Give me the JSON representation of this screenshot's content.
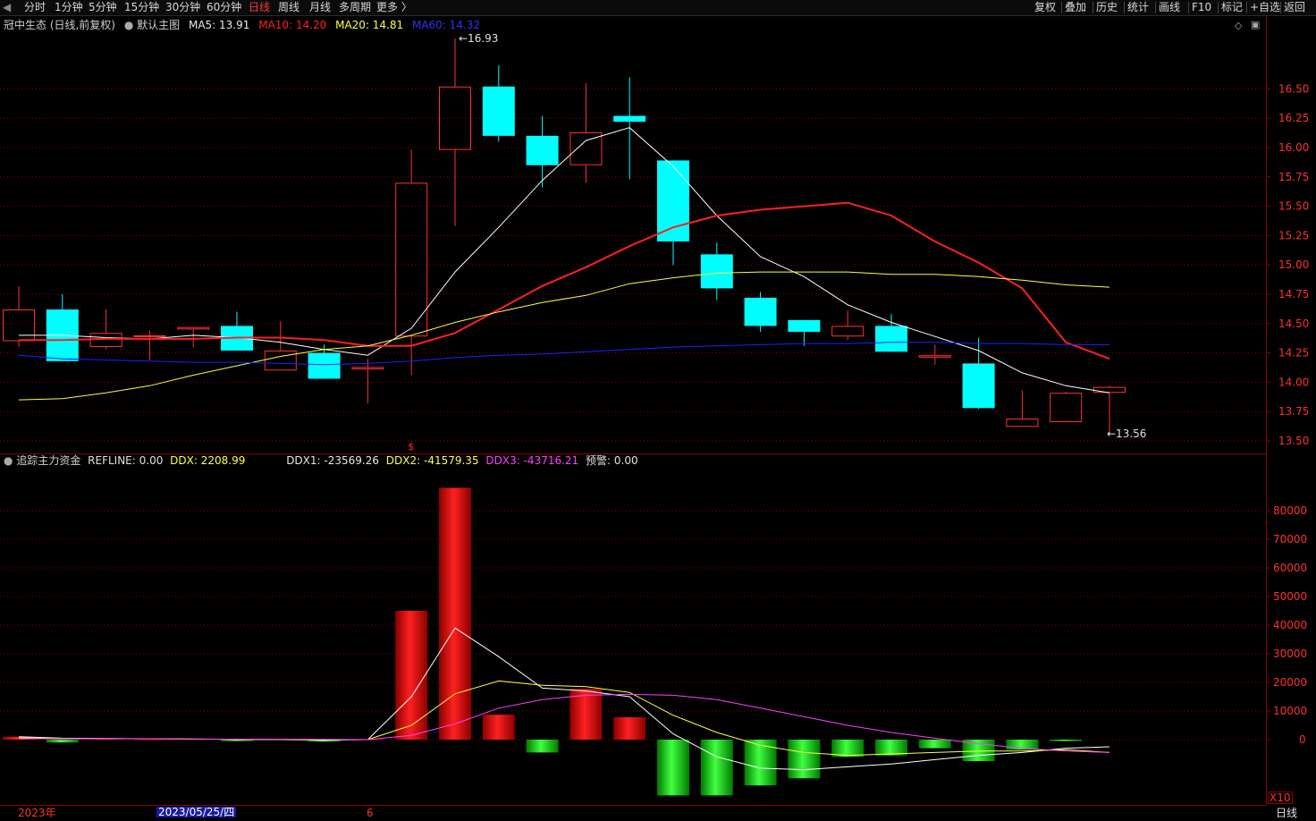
{
  "toolbar": {
    "left_items": [
      {
        "label": "分时",
        "active": false
      },
      {
        "label": "1分钟",
        "active": false
      },
      {
        "label": "5分钟",
        "active": false
      },
      {
        "label": "15分钟",
        "active": false
      },
      {
        "label": "30分钟",
        "active": false
      },
      {
        "label": "60分钟",
        "active": false
      },
      {
        "label": "日线",
        "active": true
      },
      {
        "label": "周线",
        "active": false
      },
      {
        "label": "月线",
        "active": false
      },
      {
        "label": "多周期",
        "active": false
      },
      {
        "label": "更多 〉",
        "active": false
      }
    ],
    "right_items": [
      "复权",
      "叠加",
      "历史",
      "统计",
      "画线",
      "F10",
      "标记",
      "+自选",
      "返回"
    ]
  },
  "colors": {
    "up": "#ff3232",
    "down": "#00ffff",
    "ma5": "#ffffff",
    "ma10": "#ff2020",
    "ma20": "#ffff40",
    "ma60": "#2020ff",
    "grid": "#8b0000",
    "axis_text": "#ff3030",
    "ddx1": "#ffffff",
    "ddx2": "#ffff40",
    "ddx3": "#ff40ff"
  },
  "main_header": {
    "stock": "冠中生态 (日线,前复权)",
    "template": "默认主图",
    "ma5": "MA5: 13.91",
    "ma10": "MA10: 14.20",
    "ma20": "MA20: 14.81",
    "ma60": "MA60: 14.32"
  },
  "sub_header": {
    "indicator": "追踪主力资金",
    "refline": "REFLINE: 0.00",
    "ddx": "DDX: 2208.99",
    "ddx1": "DDX1: -23569.26",
    "ddx2": "DDX2: -41579.35",
    "ddx3": "DDX3: -43716.21",
    "alert": "预警: 0.00"
  },
  "bottom_axis": {
    "year": "2023年",
    "cursor_date": "2023/05/25/四",
    "month_mark": "6",
    "period": "日线",
    "zoom": "X10"
  },
  "chart_data": [
    {
      "type": "candlestick",
      "title": "冠中生态 (日线,前复权)",
      "y_ticks": [
        13.5,
        13.75,
        14.0,
        14.25,
        14.5,
        14.75,
        15.0,
        15.25,
        15.5,
        15.75,
        16.0,
        16.25,
        16.5
      ],
      "ylim": [
        13.42,
        16.95
      ],
      "annotations": {
        "high": "16.93",
        "low": "13.56",
        "event_marker": "$"
      },
      "candles": [
        {
          "o": 14.35,
          "h": 14.82,
          "l": 14.3,
          "c": 14.62
        },
        {
          "o": 14.62,
          "h": 14.75,
          "l": 14.18,
          "c": 14.18
        },
        {
          "o": 14.3,
          "h": 14.62,
          "l": 14.28,
          "c": 14.42
        },
        {
          "o": 14.4,
          "h": 14.44,
          "l": 14.19,
          "c": 14.4
        },
        {
          "o": 14.45,
          "h": 14.47,
          "l": 14.3,
          "c": 14.47
        },
        {
          "o": 14.48,
          "h": 14.6,
          "l": 14.27,
          "c": 14.27
        },
        {
          "o": 14.1,
          "h": 14.52,
          "l": 14.1,
          "c": 14.27
        },
        {
          "o": 14.25,
          "h": 14.32,
          "l": 14.03,
          "c": 14.03
        },
        {
          "o": 14.11,
          "h": 14.2,
          "l": 13.82,
          "c": 14.13
        },
        {
          "o": 14.39,
          "h": 15.98,
          "l": 14.06,
          "c": 15.7
        },
        {
          "o": 15.98,
          "h": 16.93,
          "l": 15.33,
          "c": 16.52
        },
        {
          "o": 16.52,
          "h": 16.7,
          "l": 16.05,
          "c": 16.1
        },
        {
          "o": 16.1,
          "h": 16.27,
          "l": 15.66,
          "c": 15.85
        },
        {
          "o": 15.85,
          "h": 16.55,
          "l": 15.7,
          "c": 16.13
        },
        {
          "o": 16.27,
          "h": 16.6,
          "l": 15.73,
          "c": 16.22
        },
        {
          "o": 15.89,
          "h": 15.89,
          "l": 15.0,
          "c": 15.2
        },
        {
          "o": 15.09,
          "h": 15.19,
          "l": 14.7,
          "c": 14.8
        },
        {
          "o": 14.72,
          "h": 14.77,
          "l": 14.43,
          "c": 14.48
        },
        {
          "o": 14.53,
          "h": 14.53,
          "l": 14.31,
          "c": 14.43
        },
        {
          "o": 14.39,
          "h": 14.61,
          "l": 14.36,
          "c": 14.48
        },
        {
          "o": 14.48,
          "h": 14.58,
          "l": 14.26,
          "c": 14.26
        },
        {
          "o": 14.21,
          "h": 14.32,
          "l": 14.15,
          "c": 14.23
        },
        {
          "o": 14.16,
          "h": 14.38,
          "l": 13.77,
          "c": 13.78
        },
        {
          "o": 13.62,
          "h": 13.93,
          "l": 13.62,
          "c": 13.69
        },
        {
          "o": 13.66,
          "h": 13.92,
          "l": 13.66,
          "c": 13.91
        },
        {
          "o": 13.91,
          "h": 13.97,
          "l": 13.56,
          "c": 13.96
        }
      ],
      "series": [
        {
          "name": "MA5",
          "values": [
            14.4,
            14.4,
            14.38,
            14.37,
            14.4,
            14.38,
            14.34,
            14.28,
            14.23,
            14.46,
            14.94,
            15.32,
            15.72,
            16.06,
            16.17,
            15.84,
            15.42,
            15.07,
            14.9,
            14.66,
            14.51,
            14.39,
            14.27,
            14.08,
            13.97,
            13.91
          ]
        },
        {
          "name": "MA10",
          "values": [
            14.36,
            14.36,
            14.37,
            14.37,
            14.37,
            14.38,
            14.38,
            14.36,
            14.31,
            14.31,
            14.42,
            14.62,
            14.82,
            14.98,
            15.16,
            15.32,
            15.42,
            15.47,
            15.5,
            15.53,
            15.42,
            15.2,
            15.02,
            14.8,
            14.34,
            14.2
          ]
        },
        {
          "name": "MA20",
          "values": [
            13.85,
            13.86,
            13.91,
            13.97,
            14.06,
            14.14,
            14.22,
            14.28,
            14.31,
            14.4,
            14.51,
            14.6,
            14.68,
            14.74,
            14.84,
            14.89,
            14.93,
            14.94,
            14.94,
            14.94,
            14.92,
            14.92,
            14.9,
            14.87,
            14.83,
            14.81
          ]
        },
        {
          "name": "MA60",
          "values": [
            14.23,
            14.2,
            14.19,
            14.18,
            14.17,
            14.17,
            14.16,
            14.15,
            14.16,
            14.18,
            14.21,
            14.23,
            14.24,
            14.26,
            14.28,
            14.3,
            14.31,
            14.32,
            14.33,
            14.33,
            14.34,
            14.34,
            14.33,
            14.33,
            14.32,
            14.32
          ]
        }
      ]
    },
    {
      "type": "bar",
      "title": "追踪主力资金",
      "y_ticks": [
        0,
        10000,
        20000,
        30000,
        40000,
        50000,
        60000,
        70000,
        80000
      ],
      "ylim": [
        -22000,
        90000
      ],
      "bars": [
        1000,
        -1000,
        300,
        200,
        300,
        -500,
        200,
        -700,
        200,
        45000,
        88000,
        8700,
        -4500,
        17700,
        7800,
        -19500,
        -19500,
        -16000,
        -13500,
        -6000,
        -5500,
        -3000,
        -7500,
        -3500,
        -500,
        0
      ],
      "series": [
        {
          "name": "DDX1",
          "values": [
            1000,
            500,
            400,
            300,
            200,
            100,
            0,
            -200,
            0,
            15000,
            39000,
            29000,
            18000,
            17000,
            15000,
            2000,
            -6000,
            -10000,
            -10500,
            -9500,
            -8500,
            -7000,
            -5500,
            -4500,
            -3000,
            -2500
          ]
        },
        {
          "name": "DDX2",
          "values": [
            600,
            400,
            300,
            300,
            200,
            100,
            50,
            0,
            0,
            5000,
            16000,
            20500,
            19000,
            18500,
            16500,
            8500,
            2500,
            -2000,
            -4500,
            -5500,
            -5000,
            -4500,
            -4000,
            -4000,
            -3500,
            -4500
          ]
        },
        {
          "name": "DDX3",
          "values": [
            300,
            300,
            300,
            300,
            200,
            150,
            100,
            50,
            0,
            1500,
            5500,
            11000,
            14000,
            15500,
            15800,
            15500,
            14000,
            11000,
            8000,
            5000,
            2500,
            500,
            -1500,
            -3000,
            -4000,
            -4500
          ]
        }
      ]
    }
  ]
}
